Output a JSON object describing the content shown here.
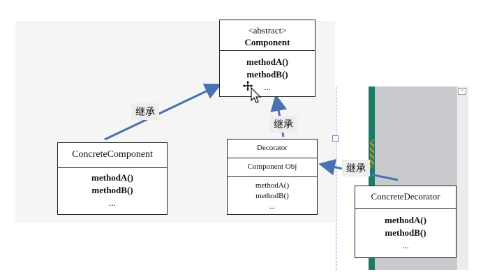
{
  "component": {
    "stereotype": "<abstract>",
    "name": "Component",
    "methods": [
      "methodA()",
      "methodB()",
      "..."
    ]
  },
  "concrete_component": {
    "name": "ConcreteComponent",
    "methods": [
      "methodA()",
      "methodB()",
      "..."
    ]
  },
  "decorator": {
    "name": "Decorator",
    "field": "Component Obj",
    "methods": [
      "methodA()",
      "methodB()",
      "..."
    ]
  },
  "concrete_decorator": {
    "name": "ConcreteDecorator",
    "methods": [
      "methodA()",
      "methodB()",
      "..."
    ]
  },
  "labels": {
    "inherit_1": "继承",
    "inherit_2": "继承",
    "inherit_3": "继承"
  },
  "colors": {
    "arrow": "#4a72b0",
    "panel_gray": "#c9cacd",
    "panel_green": "#1f7a64",
    "label_bg": "#eeeeee"
  }
}
